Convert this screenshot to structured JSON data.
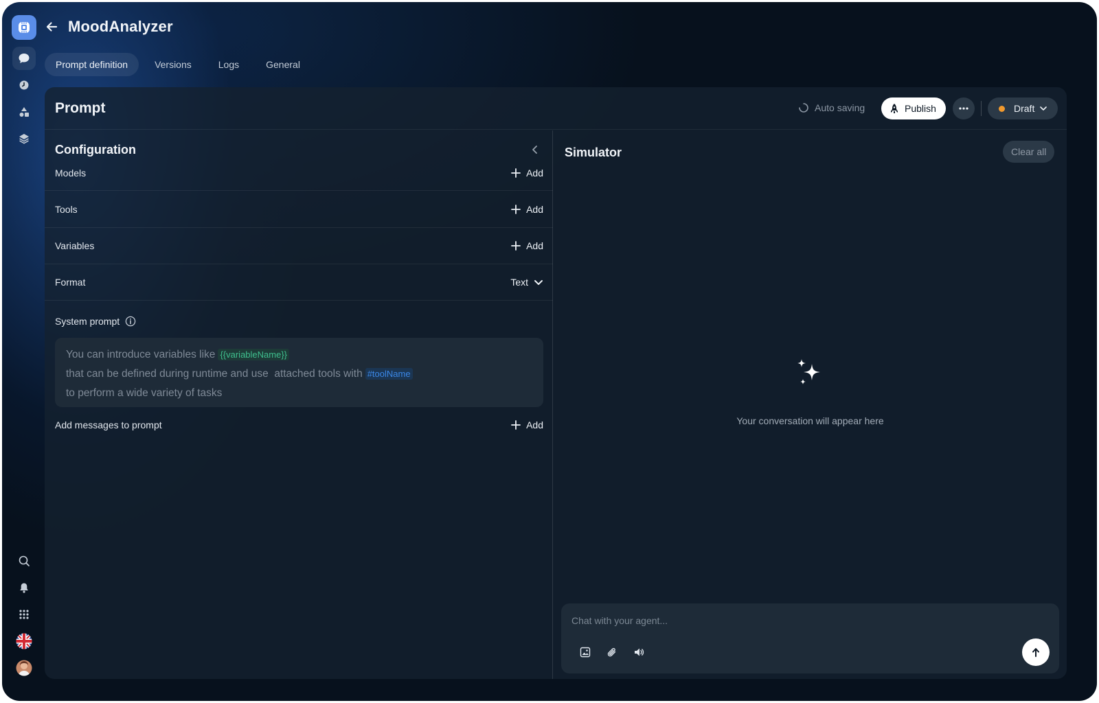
{
  "app": {
    "title": "MoodAnalyzer"
  },
  "tabs": [
    {
      "label": "Prompt definition",
      "active": true
    },
    {
      "label": "Versions"
    },
    {
      "label": "Logs"
    },
    {
      "label": "General"
    }
  ],
  "rail": {
    "top_items": [
      "chat-icon",
      "clock-icon",
      "shapes-icon",
      "layers-icon"
    ],
    "bottom_items": [
      "search-icon",
      "bell-icon",
      "apps-grid-icon",
      "uk-flag-icon",
      "user-avatar"
    ]
  },
  "header": {
    "title": "Prompt",
    "autosave_label": "Auto saving",
    "publish_label": "Publish",
    "status_label": "Draft",
    "status_color": "#f29a2e"
  },
  "configuration": {
    "title": "Configuration",
    "rows": [
      {
        "label": "Models",
        "action": "Add"
      },
      {
        "label": "Tools",
        "action": "Add"
      },
      {
        "label": "Variables",
        "action": "Add"
      },
      {
        "label": "Format",
        "value": "Text"
      }
    ],
    "system_prompt": {
      "label": "System prompt",
      "line1": "You can introduce variables like",
      "variable_chip": "{{variableName}}",
      "line2": "that can be defined during runtime and use  attached tools with",
      "tool_chip": "#toolName",
      "line3": "to perform a wide variety of tasks"
    },
    "messages": {
      "label": "Add messages to prompt",
      "action": "Add"
    }
  },
  "simulator": {
    "title": "Simulator",
    "clear_label": "Clear all",
    "empty_text": "Your conversation will appear here",
    "input_placeholder": "Chat with your agent..."
  },
  "colors": {
    "accent": "#5a8de8",
    "background": "#07111d",
    "panel": "#14212f",
    "variable_chip": "#3fbf8e",
    "tool_chip": "#3b87e6"
  }
}
